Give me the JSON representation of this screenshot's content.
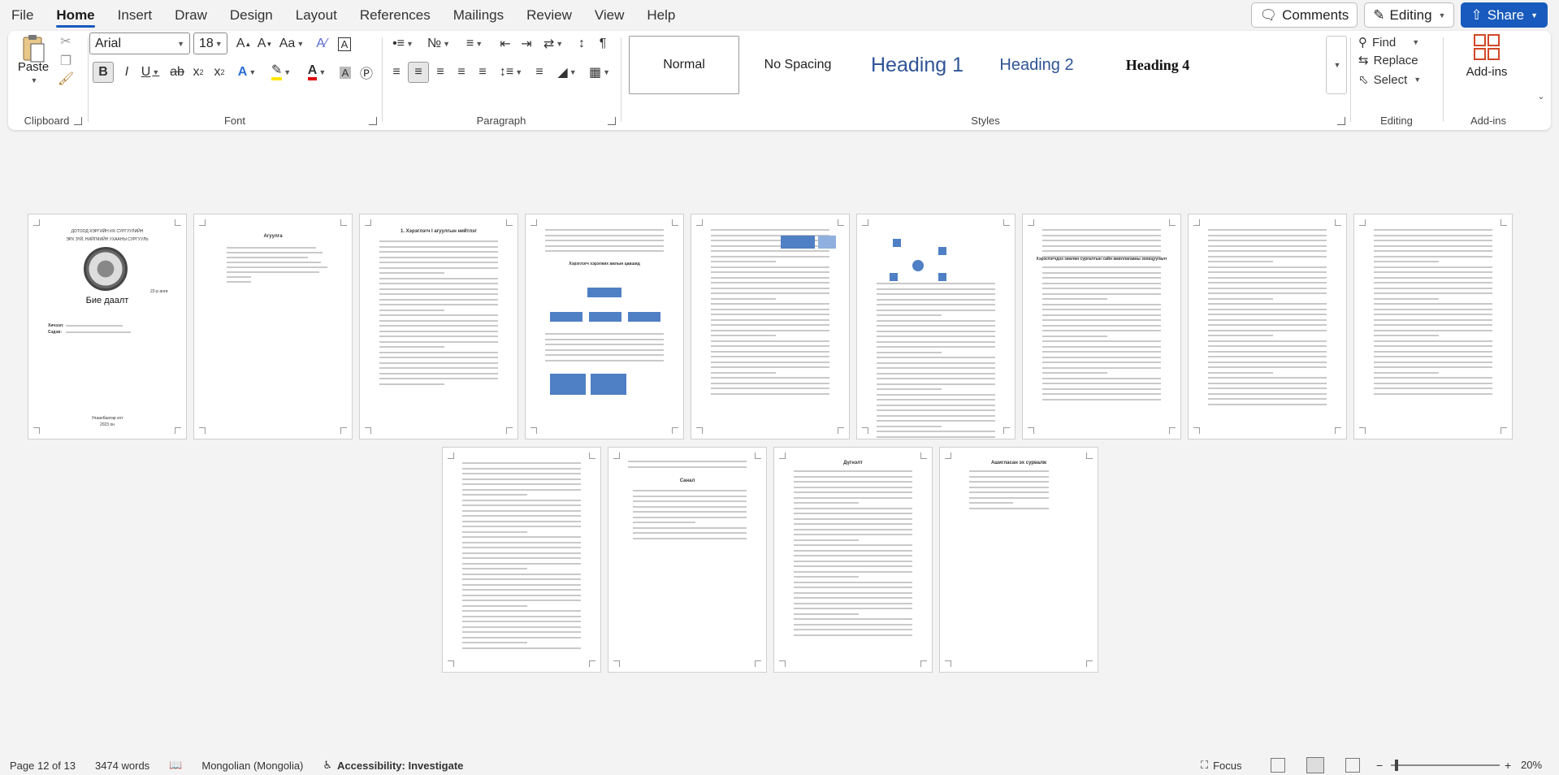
{
  "menu": {
    "items": [
      "File",
      "Home",
      "Insert",
      "Draw",
      "Design",
      "Layout",
      "References",
      "Mailings",
      "Review",
      "View",
      "Help"
    ],
    "active": "Home",
    "comments_label": "Comments",
    "editing_label": "Editing",
    "share_label": "Share"
  },
  "ribbon": {
    "clipboard": {
      "label": "Clipboard",
      "paste_label": "Paste"
    },
    "font": {
      "label": "Font",
      "font_name": "Arial",
      "font_size": "18"
    },
    "paragraph": {
      "label": "Paragraph"
    },
    "styles": {
      "label": "Styles",
      "items": [
        "Normal",
        "No Spacing",
        "Heading 1",
        "Heading 2",
        "Heading 4"
      ]
    },
    "editing": {
      "label": "Editing",
      "find_label": "Find",
      "replace_label": "Replace",
      "select_label": "Select"
    },
    "addins": {
      "label": "Add-ins",
      "button_label": "Add-ins"
    }
  },
  "pages": {
    "p1": {
      "line1": "ДОТООД ХЭРГИЙН ИХ СУРГУУЛИЙН",
      "line2": "ЭРХ ЗҮЙ, НИЙГМИЙН УХААНЫ СУРГУУЛЬ",
      "title": "Бие даалт",
      "group": "22-р анги",
      "author_label": "Хичээл:",
      "topic_label": "Сэдэв:",
      "city": "Улаанбаатар хот",
      "year": "2023 он"
    },
    "p2_title": "Агуулга",
    "p3_title": "1. Хэрэглэгч I агуулгын нийтлэг",
    "p4_title": "Хэрэглэгч хэрэгжих ажлын цаашид",
    "p7_title": "Хэрэглэгчдээ зөөлөн сургалтын сайн ажиллагааны зохицуулалт",
    "p11_title": "Санал",
    "p12_title": "Дүгнэлт",
    "p13_title": "Ашигласан эх сурвалж"
  },
  "status": {
    "page": "Page 12 of 13",
    "words": "3474 words",
    "language": "Mongolian (Mongolia)",
    "accessibility": "Accessibility: Investigate",
    "focus": "Focus",
    "zoom": "20%"
  },
  "colors": {
    "accent": "#185abd",
    "diagram_blue": "#4f7fc4"
  }
}
